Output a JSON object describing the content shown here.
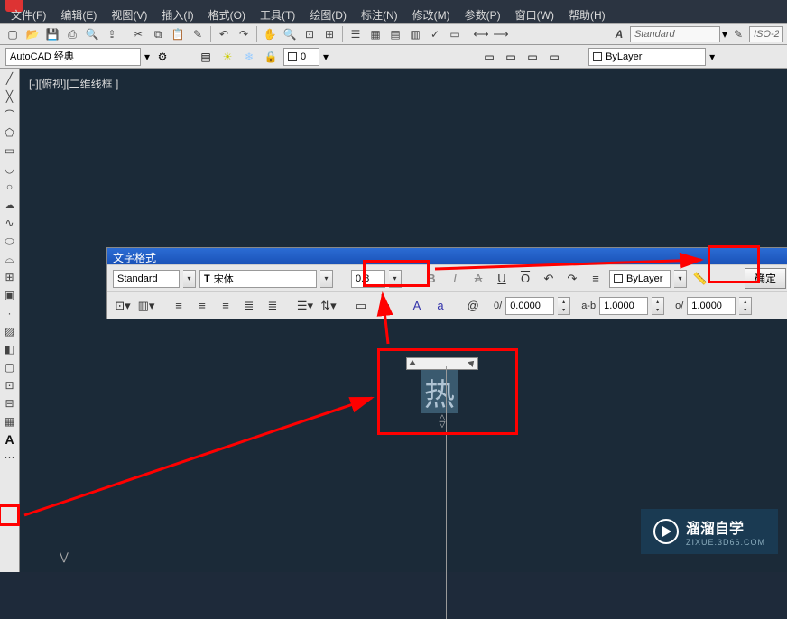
{
  "menubar": {
    "file": "文件(F)",
    "edit": "编辑(E)",
    "view": "视图(V)",
    "insert": "插入(I)",
    "format": "格式(O)",
    "tools": "工具(T)",
    "draw": "绘图(D)",
    "dimension": "标注(N)",
    "modify": "修改(M)",
    "params": "参数(P)",
    "window": "窗口(W)",
    "help": "帮助(H)"
  },
  "toolbar1": {
    "text_style": "Standard",
    "dim_style": "ISO-2"
  },
  "layerbar": {
    "workspace": "AutoCAD 经典",
    "layer_combo": "0",
    "bylayer": "ByLayer"
  },
  "viewport": {
    "label": "[-][俯视][二维线框 ]"
  },
  "text_format": {
    "title": "文字格式",
    "style": "Standard",
    "font": "宋体",
    "font_prefix": "T",
    "height": "0.8",
    "color": "ByLayer",
    "ok": "确定",
    "tracking": "0.0000",
    "width_factor": "1.0000",
    "oblique": "1.0000",
    "o_label": "0/",
    "at": "@",
    "ab": "a-b",
    "o_slash": "o/",
    "aA": "A",
    "smallA": "a"
  },
  "text_edit": {
    "content": "热"
  },
  "watermark": {
    "main": "溜溜自学",
    "sub": "ZIXUE.3D66.COM"
  }
}
